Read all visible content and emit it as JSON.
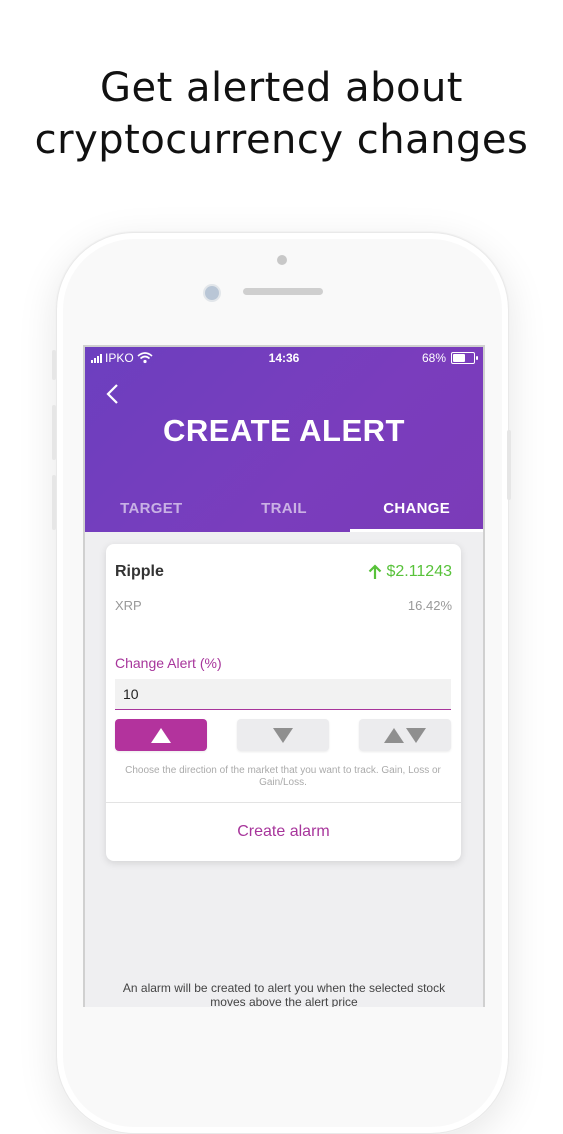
{
  "headline": {
    "line1": "Get alerted about",
    "line2": "cryptocurrency changes"
  },
  "statusbar": {
    "carrier": "IPKO",
    "time": "14:36",
    "battery": "68%",
    "battery_level": 0.68
  },
  "header": {
    "title": "CREATE ALERT"
  },
  "tabs": [
    {
      "label": "TARGET"
    },
    {
      "label": "TRAIL"
    },
    {
      "label": "CHANGE"
    }
  ],
  "coin": {
    "name": "Ripple",
    "price": "$2.11243",
    "symbol": "XRP",
    "change": "16.42%"
  },
  "form": {
    "label": "Change Alert (%)",
    "value": "10",
    "helper": "Choose the direction of the market that you want to track. Gain, Loss or Gain/Loss.",
    "submit": "Create alarm"
  },
  "directions": [
    "up-icon",
    "down-icon",
    "up-down-icon"
  ],
  "footer": "An alarm will be created to alert you when the selected stock moves above the alert price",
  "colors": {
    "header": "#7a3dbd",
    "accent": "#b3339d",
    "price_up": "#58c23a"
  }
}
